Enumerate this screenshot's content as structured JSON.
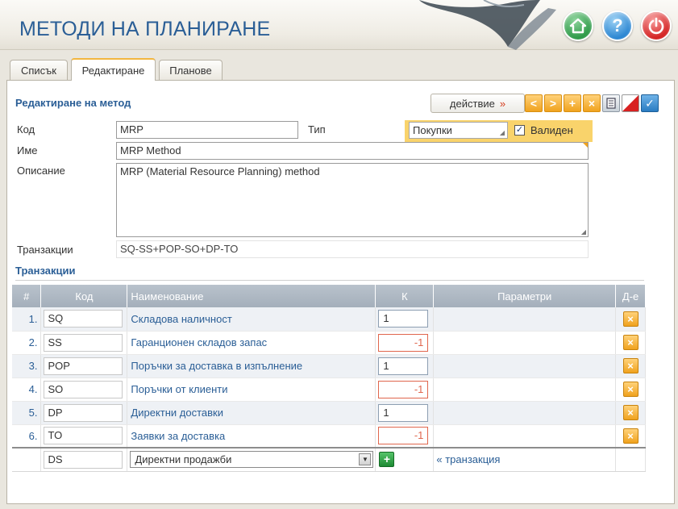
{
  "app": {
    "title": "МЕТОДИ НА ПЛАНИРАНЕ"
  },
  "header_buttons": [
    {
      "icon": "home-icon"
    },
    {
      "icon": "help-icon",
      "glyph": "?"
    },
    {
      "icon": "power-icon"
    }
  ],
  "tabs": [
    {
      "label": "Списък"
    },
    {
      "label": "Редактиране",
      "active": true
    },
    {
      "label": "Планове"
    }
  ],
  "form": {
    "section_title": "Редактиране на метод",
    "action_label": "действие",
    "action_arrow": "»",
    "code_label": "Код",
    "code_value": "MRP",
    "type_label": "Тип",
    "type_value": "Покупки",
    "valid_label": "Валиден",
    "valid_checked": true,
    "name_label": "Име",
    "name_value": "MRP Method",
    "description_label": "Описание",
    "description_value": "MRP (Material Resource Planning) method",
    "transactions_label": "Транзакции",
    "transactions_value": "SQ-SS+POP-SO+DP-TO"
  },
  "toolbar": [
    {
      "icon": "prev-icon",
      "glyph": "<"
    },
    {
      "icon": "next-icon",
      "glyph": ">"
    },
    {
      "icon": "add-icon",
      "glyph": "+"
    },
    {
      "icon": "delete-icon",
      "glyph": "×"
    },
    {
      "icon": "print-icon"
    },
    {
      "icon": "cancel-icon"
    },
    {
      "icon": "save-icon",
      "glyph": "✓"
    }
  ],
  "transactions": {
    "title": "Транзакции",
    "columns": [
      "#",
      "Код",
      "Наименование",
      "К",
      "Параметри",
      "Д-е"
    ],
    "rows": [
      {
        "num": "1.",
        "code": "SQ",
        "name": "Складова наличност",
        "k": "1"
      },
      {
        "num": "2.",
        "code": "SS",
        "name": "Гаранционен складов запас",
        "k": "-1"
      },
      {
        "num": "3.",
        "code": "POP",
        "name": "Поръчки за доставка в изпълнение",
        "k": "1"
      },
      {
        "num": "4.",
        "code": "SO",
        "name": "Поръчки от клиенти",
        "k": "-1"
      },
      {
        "num": "5.",
        "code": "DP",
        "name": "Директни доставки",
        "k": "1"
      },
      {
        "num": "6.",
        "code": "TO",
        "name": "Заявки за доставка",
        "k": "-1"
      }
    ],
    "new_row": {
      "code": "DS",
      "name_select": "Директни продажби",
      "add_link": "« транзакция"
    }
  },
  "colors": {
    "title_blue": "#2a5e96",
    "accent_orange": "#f0a21e",
    "negative_red": "#e0664d",
    "header_gray": "#a4afbb"
  }
}
